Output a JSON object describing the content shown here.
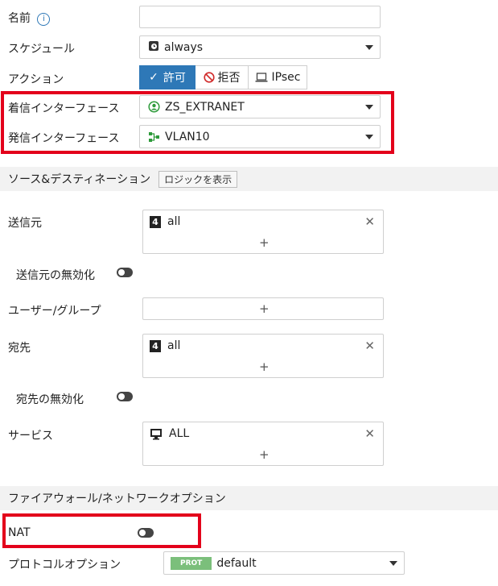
{
  "labels": {
    "name": "名前",
    "schedule": "スケジュール",
    "action": "アクション",
    "incoming": "着信インターフェース",
    "outgoing": "発信インターフェース",
    "source": "送信元",
    "negate_source": "送信元の無効化",
    "user_group": "ユーザー/グループ",
    "destination": "宛先",
    "negate_destination": "宛先の無効化",
    "service": "サービス",
    "nat": "NAT",
    "protocol_options": "プロトコルオプション"
  },
  "schedule": {
    "value": "always"
  },
  "action": {
    "accept": "許可",
    "deny": "拒否",
    "ipsec": "IPsec"
  },
  "incoming": {
    "value": "ZS_EXTRANET"
  },
  "outgoing": {
    "value": "VLAN10"
  },
  "sections": {
    "source_dest": "ソース&デスティネーション",
    "show_logic": "ロジックを表示",
    "firewall_network": "ファイアウォール/ネットワークオプション"
  },
  "source": {
    "value": "all"
  },
  "destination": {
    "value": "all"
  },
  "service": {
    "value": "ALL"
  },
  "protocol": {
    "badge": "PROT",
    "value": "default"
  },
  "glyphs": {
    "plus": "+",
    "remove": "✕",
    "check": "✓",
    "info": "i"
  },
  "colors": {
    "accent": "#2e78b7",
    "highlight": "#e3001b",
    "prot_badge": "#7bbf7b"
  }
}
